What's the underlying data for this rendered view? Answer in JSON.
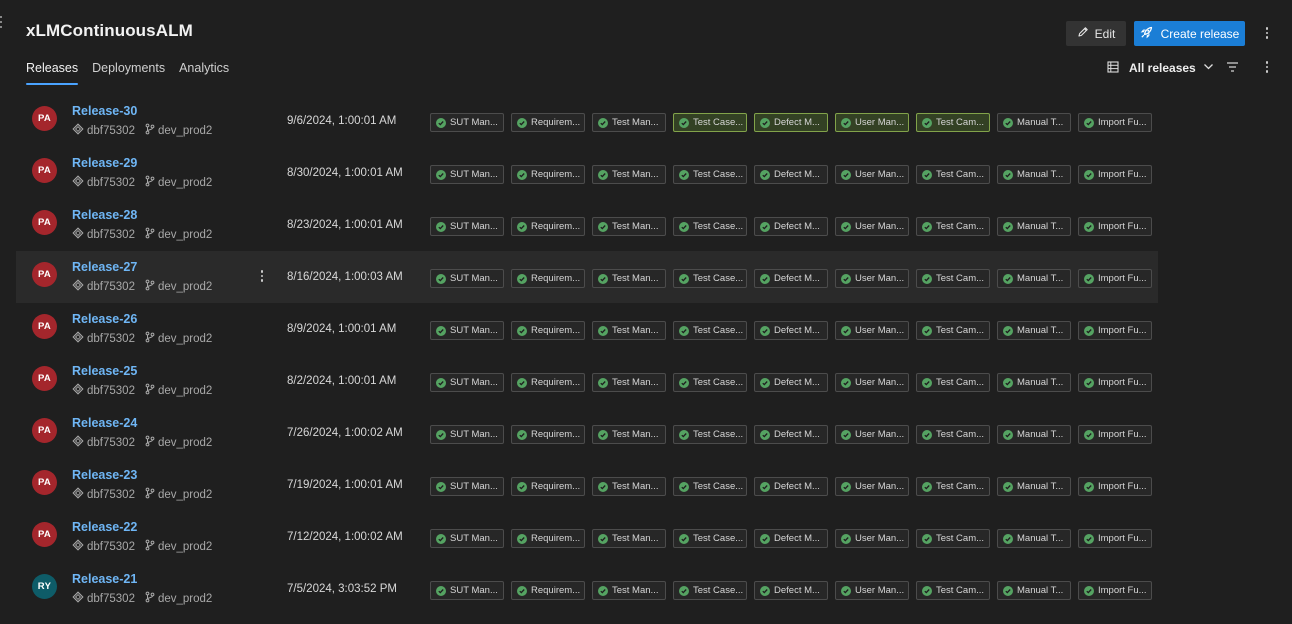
{
  "pipeline": {
    "title": "xLMContinuousALM"
  },
  "tabs": [
    {
      "label": "Releases",
      "active": true
    },
    {
      "label": "Deployments",
      "active": false
    },
    {
      "label": "Analytics",
      "active": false
    }
  ],
  "toolbar": {
    "edit_label": "Edit",
    "create_label": "Create release",
    "filter_label": "All releases"
  },
  "colors": {
    "accent": "#1b7ed6",
    "link": "#6fb6f5",
    "success": "#55a362",
    "avatar_pa": "#a4262c",
    "avatar_ry": "#0e5c68"
  },
  "stage_names": [
    "SUT Man...",
    "Requirem...",
    "Test Man...",
    "Test Case...",
    "Defect M...",
    "User Man...",
    "Test Cam...",
    "Manual T...",
    "Import Fu..."
  ],
  "releases": [
    {
      "name": "Release-30",
      "initials": "PA",
      "commit": "dbf75302",
      "branch": "dev_prod2",
      "date": "9/6/2024, 1:00:01 AM",
      "highlighted_stages": [
        3,
        4,
        5,
        6
      ]
    },
    {
      "name": "Release-29",
      "initials": "PA",
      "commit": "dbf75302",
      "branch": "dev_prod2",
      "date": "8/30/2024, 1:00:01 AM",
      "highlighted_stages": []
    },
    {
      "name": "Release-28",
      "initials": "PA",
      "commit": "dbf75302",
      "branch": "dev_prod2",
      "date": "8/23/2024, 1:00:01 AM",
      "highlighted_stages": []
    },
    {
      "name": "Release-27",
      "initials": "PA",
      "commit": "dbf75302",
      "branch": "dev_prod2",
      "date": "8/16/2024, 1:00:03 AM",
      "highlighted_stages": [],
      "hovered": true
    },
    {
      "name": "Release-26",
      "initials": "PA",
      "commit": "dbf75302",
      "branch": "dev_prod2",
      "date": "8/9/2024, 1:00:01 AM",
      "highlighted_stages": []
    },
    {
      "name": "Release-25",
      "initials": "PA",
      "commit": "dbf75302",
      "branch": "dev_prod2",
      "date": "8/2/2024, 1:00:01 AM",
      "highlighted_stages": []
    },
    {
      "name": "Release-24",
      "initials": "PA",
      "commit": "dbf75302",
      "branch": "dev_prod2",
      "date": "7/26/2024, 1:00:02 AM",
      "highlighted_stages": []
    },
    {
      "name": "Release-23",
      "initials": "PA",
      "commit": "dbf75302",
      "branch": "dev_prod2",
      "date": "7/19/2024, 1:00:01 AM",
      "highlighted_stages": []
    },
    {
      "name": "Release-22",
      "initials": "PA",
      "commit": "dbf75302",
      "branch": "dev_prod2",
      "date": "7/12/2024, 1:00:02 AM",
      "highlighted_stages": []
    },
    {
      "name": "Release-21",
      "initials": "RY",
      "commit": "dbf75302",
      "branch": "dev_prod2",
      "date": "7/5/2024, 3:03:52 PM",
      "highlighted_stages": []
    }
  ],
  "icons": {
    "edit": "pencil-icon",
    "create": "rocket-icon",
    "filter_view": "list-view-icon",
    "dropdown": "chevron-down-icon",
    "funnel": "filter-icon",
    "more": "more-vertical-icon",
    "commit": "commit-icon",
    "branch": "branch-icon",
    "stage_ok": "check-circle-icon"
  }
}
